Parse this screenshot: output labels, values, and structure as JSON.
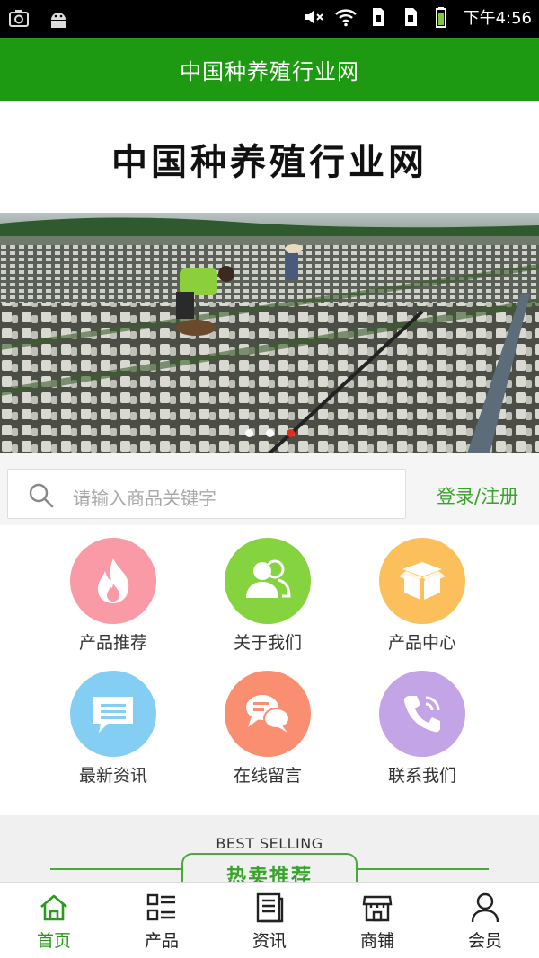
{
  "status_bar": {
    "time": "下午4:56",
    "icons": [
      "screenshot-icon",
      "android-icon",
      "mute-icon",
      "wifi-icon",
      "sim1-icon",
      "sim2-icon",
      "battery-icon"
    ]
  },
  "header": {
    "title": "中国种养殖行业网"
  },
  "logo": {
    "text": "中国种养殖行业网"
  },
  "banner": {
    "slides": 3,
    "active_slide": 3
  },
  "search": {
    "placeholder": "请输入商品关键字",
    "login_label": "登录/注册"
  },
  "grid": {
    "items": [
      {
        "label": "产品推荐",
        "icon": "flame-icon",
        "color": "#fa9aa6"
      },
      {
        "label": "关于我们",
        "icon": "people-icon",
        "color": "#85d33f"
      },
      {
        "label": "产品中心",
        "icon": "box-icon",
        "color": "#fbbf5c"
      },
      {
        "label": "最新资讯",
        "icon": "message-icon",
        "color": "#83cef2"
      },
      {
        "label": "在线留言",
        "icon": "chat-icon",
        "color": "#f98f70"
      },
      {
        "label": "联系我们",
        "icon": "phone-icon",
        "color": "#c3a4e6"
      }
    ]
  },
  "best_selling": {
    "subtitle": "BEST SELLING",
    "title_part1": "热卖",
    "title_part2": "推荐"
  },
  "bottom_nav": {
    "items": [
      {
        "label": "首页",
        "icon": "home-icon",
        "active": true
      },
      {
        "label": "产品",
        "icon": "list-icon",
        "active": false
      },
      {
        "label": "资讯",
        "icon": "news-icon",
        "active": false
      },
      {
        "label": "商铺",
        "icon": "shop-icon",
        "active": false
      },
      {
        "label": "会员",
        "icon": "user-icon",
        "active": false
      }
    ]
  },
  "colors": {
    "brand_green": "#1e9a12",
    "accent_green": "#38a32a",
    "dot_active": "#e52a1e"
  }
}
